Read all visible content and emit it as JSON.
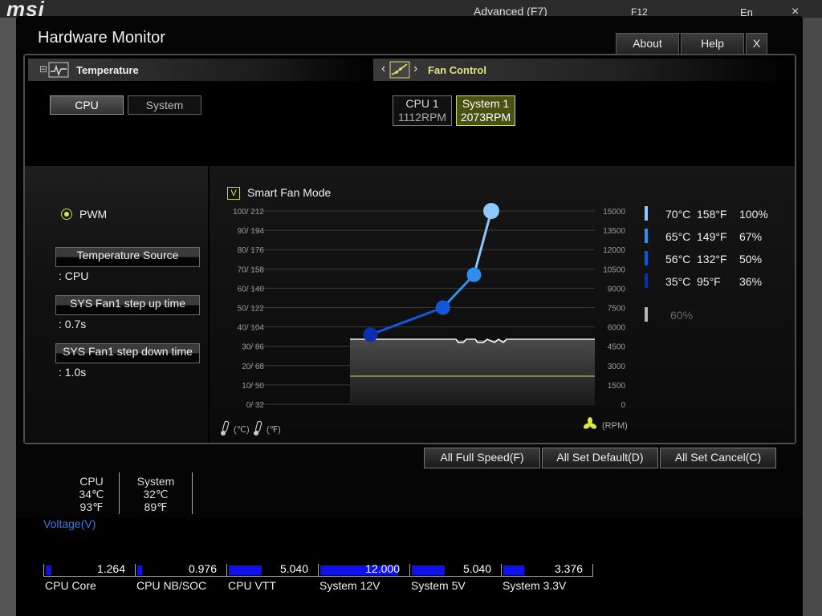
{
  "background": {
    "brand": "msi",
    "mode_label": "Advanced (F7)",
    "f12_label": "F12",
    "lang_label": "En",
    "close_glyph": "×"
  },
  "window": {
    "title": "Hardware Monitor",
    "buttons": {
      "about": "About",
      "help": "Help",
      "close": "X"
    }
  },
  "temperature_tab": {
    "label": "Temperature",
    "collapse_glyph": "⊟",
    "sources": [
      "CPU",
      "System"
    ],
    "selected": "CPU"
  },
  "fan_control_tab": {
    "label": "Fan Control",
    "prev_glyph": "‹",
    "next_glyph": "›",
    "fans": [
      {
        "name": "CPU 1",
        "rpm": "1112RPM",
        "selected": false
      },
      {
        "name": "System 1",
        "rpm": "2073RPM",
        "selected": true
      }
    ]
  },
  "left_settings": {
    "pwm_label": "PWM",
    "temperature_source_label": "Temperature Source",
    "temperature_source_value": ": CPU",
    "step_up_label": "SYS Fan1 step up time",
    "step_up_value": ": 0.7s",
    "step_down_label": "SYS Fan1 step down time",
    "step_down_value": ": 1.0s"
  },
  "smart_fan": {
    "checkbox_glyph": "V",
    "label": "Smart Fan Mode",
    "checked": true
  },
  "chart_data": {
    "type": "line",
    "left_ticks": [
      "100/ 212",
      "90/ 194",
      "80/ 176",
      "70/ 158",
      "60/ 140",
      "50/ 122",
      "40/ 104",
      "30/  86",
      "20/  68",
      "10/  50",
      "0/  32"
    ],
    "right_ticks": [
      "15000",
      "13500",
      "12000",
      "10500",
      "9000",
      "7500",
      "6000",
      "4500",
      "3000",
      "1500",
      "0"
    ],
    "xlabel_c": "(℃)",
    "xlabel_f": "(℉)",
    "rpm_label": "(RPM)",
    "xlim": [
      0,
      100
    ],
    "ylim": [
      0,
      100
    ],
    "series": [
      {
        "x": [
          35,
          56,
          65,
          70
        ],
        "y": [
          36,
          50,
          67,
          100
        ]
      }
    ],
    "point_colors": [
      "#0a2fb0",
      "#1356dd",
      "#2f8ff0",
      "#8cc8f8"
    ],
    "line_color": "#2a6fe8"
  },
  "fan_legend": [
    {
      "c": "70°C",
      "f": "158°F",
      "pct": "100%",
      "color": "#8cc8f8"
    },
    {
      "c": "65°C",
      "f": "149°F",
      "pct": "67%",
      "color": "#2f8ff0"
    },
    {
      "c": "56°C",
      "f": "132°F",
      "pct": "50%",
      "color": "#1356dd"
    },
    {
      "c": "35°C",
      "f": "95°F",
      "pct": "36%",
      "color": "#0a2fb0"
    }
  ],
  "fan_legend_extra": {
    "pct": "60%",
    "color": "#b5b5b5"
  },
  "bottom_buttons": {
    "full_speed": "All Full Speed(F)",
    "set_default": "All Set Default(D)",
    "set_cancel": "All Set Cancel(C)"
  },
  "temps": [
    {
      "name": "CPU",
      "c": "34℃",
      "f": "93℉"
    },
    {
      "name": "System",
      "c": "32℃",
      "f": "89℉"
    }
  ],
  "voltage": {
    "title": "Voltage(V)",
    "rails": [
      {
        "name": "CPU Core",
        "value": "1.264",
        "level": 0.06
      },
      {
        "name": "CPU NB/SOC",
        "value": "0.976",
        "level": 0.05
      },
      {
        "name": "CPU VTT",
        "value": "5.040",
        "level": 0.37
      },
      {
        "name": "System 12V",
        "value": "12.000",
        "level": 0.88
      },
      {
        "name": "System 5V",
        "value": "5.040",
        "level": 0.37
      },
      {
        "name": "System 3.3V",
        "value": "3.376",
        "level": 0.24
      }
    ]
  }
}
